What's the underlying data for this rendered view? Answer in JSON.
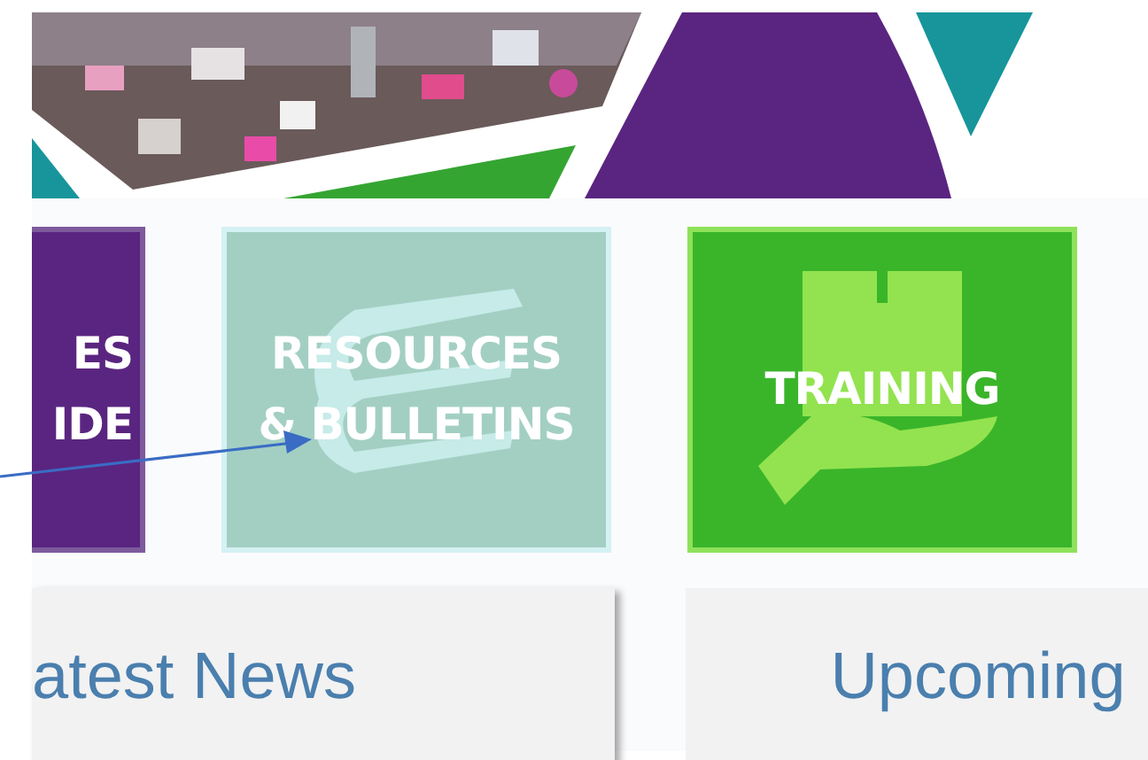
{
  "tiles": [
    {
      "kind": "partial",
      "color": "#5a2580",
      "lines": [
        "ES",
        "IDE"
      ]
    },
    {
      "kind": "books",
      "color": "#a3cfc3",
      "lines": [
        "RESOURCES",
        "& BULLETINS"
      ]
    },
    {
      "kind": "training",
      "color": "#3ab52a",
      "lines": [
        "TRAINING"
      ]
    }
  ],
  "cards": [
    {
      "title": "atest News"
    },
    {
      "title": "Upcoming"
    }
  ]
}
